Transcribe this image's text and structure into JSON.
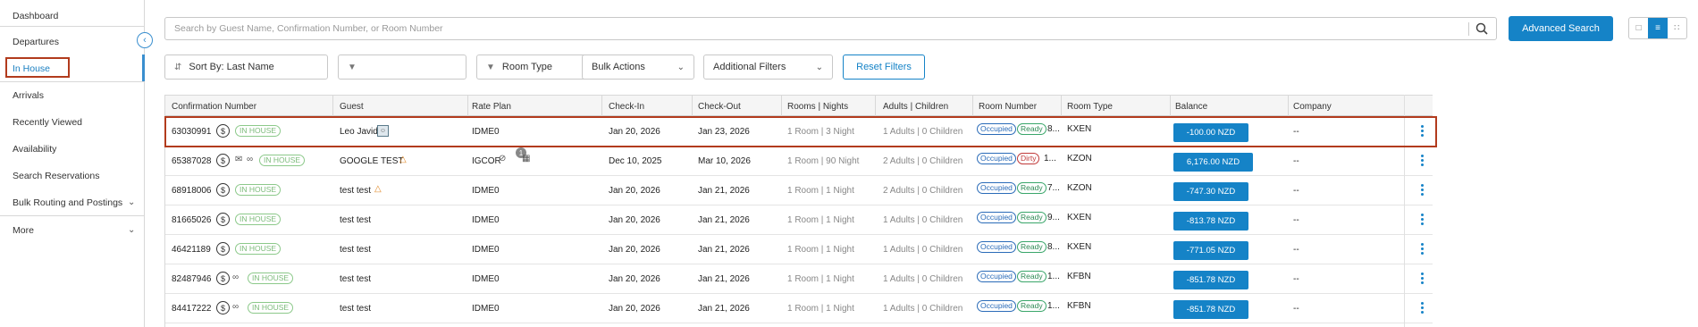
{
  "sidebar": {
    "items": [
      {
        "label": "Dashboard"
      },
      {
        "label": "Departures"
      },
      {
        "label": "In House"
      },
      {
        "label": "Arrivals"
      },
      {
        "label": "Recently Viewed"
      },
      {
        "label": "Availability"
      },
      {
        "label": "Search Reservations"
      },
      {
        "label": "Bulk Routing and Postings"
      },
      {
        "label": "More"
      }
    ],
    "active_item": "In House"
  },
  "search": {
    "placeholder": "Search by Guest Name, Confirmation Number, or Room Number",
    "value": "",
    "advanced_label": "Advanced Search"
  },
  "filters": {
    "sort_label": "Sort By: Last Name",
    "room_type_label": "Room Type",
    "bulk_actions_label": "Bulk Actions",
    "additional_filters_label": "Additional Filters",
    "reset_label": "Reset Filters"
  },
  "table": {
    "headers": [
      "Confirmation Number",
      "Guest",
      "Rate Plan",
      "Check-In",
      "Check-Out",
      "Rooms | Nights",
      "Adults | Children",
      "Room Number",
      "Room Type",
      "Balance",
      "Company"
    ],
    "rows": [
      {
        "conf": "63030991",
        "status": "IN HOUSE",
        "guest": "Leo Javid",
        "rate": "IDME0",
        "checkin": "Jan 20, 2026",
        "checkout": "Jan 23, 2026",
        "rooms_nights": "1 Room | 3 Night",
        "adults_children": "1 Adults | 0 Children",
        "occ": "Occupied",
        "hk": "Ready",
        "room_no": "8...",
        "room_type": "KXEN",
        "balance": "-100.00 NZD",
        "company": "--"
      },
      {
        "conf": "65387028",
        "status": "IN HOUSE",
        "guest": "GOOGLE TEST",
        "rate": "IGCOR",
        "checkin": "Dec 10, 2025",
        "checkout": "Mar 10, 2026",
        "rooms_nights": "1 Room | 90 Night",
        "adults_children": "2 Adults | 0 Children",
        "occ": "Occupied",
        "hk": "Dirty",
        "room_no": "1...",
        "room_type": "KZON",
        "balance": "6,176.00 NZD",
        "company": "--"
      },
      {
        "conf": "68918006",
        "status": "IN HOUSE",
        "guest": "test test",
        "rate": "IDME0",
        "checkin": "Jan 20, 2026",
        "checkout": "Jan 21, 2026",
        "rooms_nights": "1 Room | 1 Night",
        "adults_children": "2 Adults | 0 Children",
        "occ": "Occupied",
        "hk": "Ready",
        "room_no": "7...",
        "room_type": "KZON",
        "balance": "-747.30 NZD",
        "company": "--"
      },
      {
        "conf": "81665026",
        "status": "IN HOUSE",
        "guest": "test test",
        "rate": "IDME0",
        "checkin": "Jan 20, 2026",
        "checkout": "Jan 21, 2026",
        "rooms_nights": "1 Room | 1 Night",
        "adults_children": "1 Adults | 0 Children",
        "occ": "Occupied",
        "hk": "Ready",
        "room_no": "9...",
        "room_type": "KXEN",
        "balance": "-813.78 NZD",
        "company": "--"
      },
      {
        "conf": "46421189",
        "status": "IN HOUSE",
        "guest": "test test",
        "rate": "IDME0",
        "checkin": "Jan 20, 2026",
        "checkout": "Jan 21, 2026",
        "rooms_nights": "1 Room | 1 Night",
        "adults_children": "1 Adults | 0 Children",
        "occ": "Occupied",
        "hk": "Ready",
        "room_no": "8...",
        "room_type": "KXEN",
        "balance": "-771.05 NZD",
        "company": "--"
      },
      {
        "conf": "82487946",
        "status": "IN HOUSE",
        "guest": "test test",
        "rate": "IDME0",
        "checkin": "Jan 20, 2026",
        "checkout": "Jan 21, 2026",
        "rooms_nights": "1 Room | 1 Night",
        "adults_children": "1 Adults | 0 Children",
        "occ": "Occupied",
        "hk": "Ready",
        "room_no": "1...",
        "room_type": "KFBN",
        "balance": "-851.78 NZD",
        "company": "--"
      },
      {
        "conf": "84417222",
        "status": "IN HOUSE",
        "guest": "test test",
        "rate": "IDME0",
        "checkin": "Jan 20, 2026",
        "checkout": "Jan 21, 2026",
        "rooms_nights": "1 Room | 1 Night",
        "adults_children": "1 Adults | 0 Children",
        "occ": "Occupied",
        "hk": "Ready",
        "room_no": "1...",
        "room_type": "KFBN",
        "balance": "-851.78 NZD",
        "company": "--"
      }
    ]
  },
  "icons": {
    "folio": "dollar-circle-icon",
    "message": "message-icon",
    "link": "link-icon",
    "group": "group-icon",
    "id_card": "id-card-icon",
    "hidden": "eye-slash-icon",
    "notification_count": "1"
  },
  "colors": {
    "accent": "#1583c7",
    "highlight": "#b23b1d",
    "in_house": "#7cbb7a",
    "occupied": "#2a6bb8",
    "ready": "#2d8a54",
    "dirty": "#c03a3a"
  }
}
